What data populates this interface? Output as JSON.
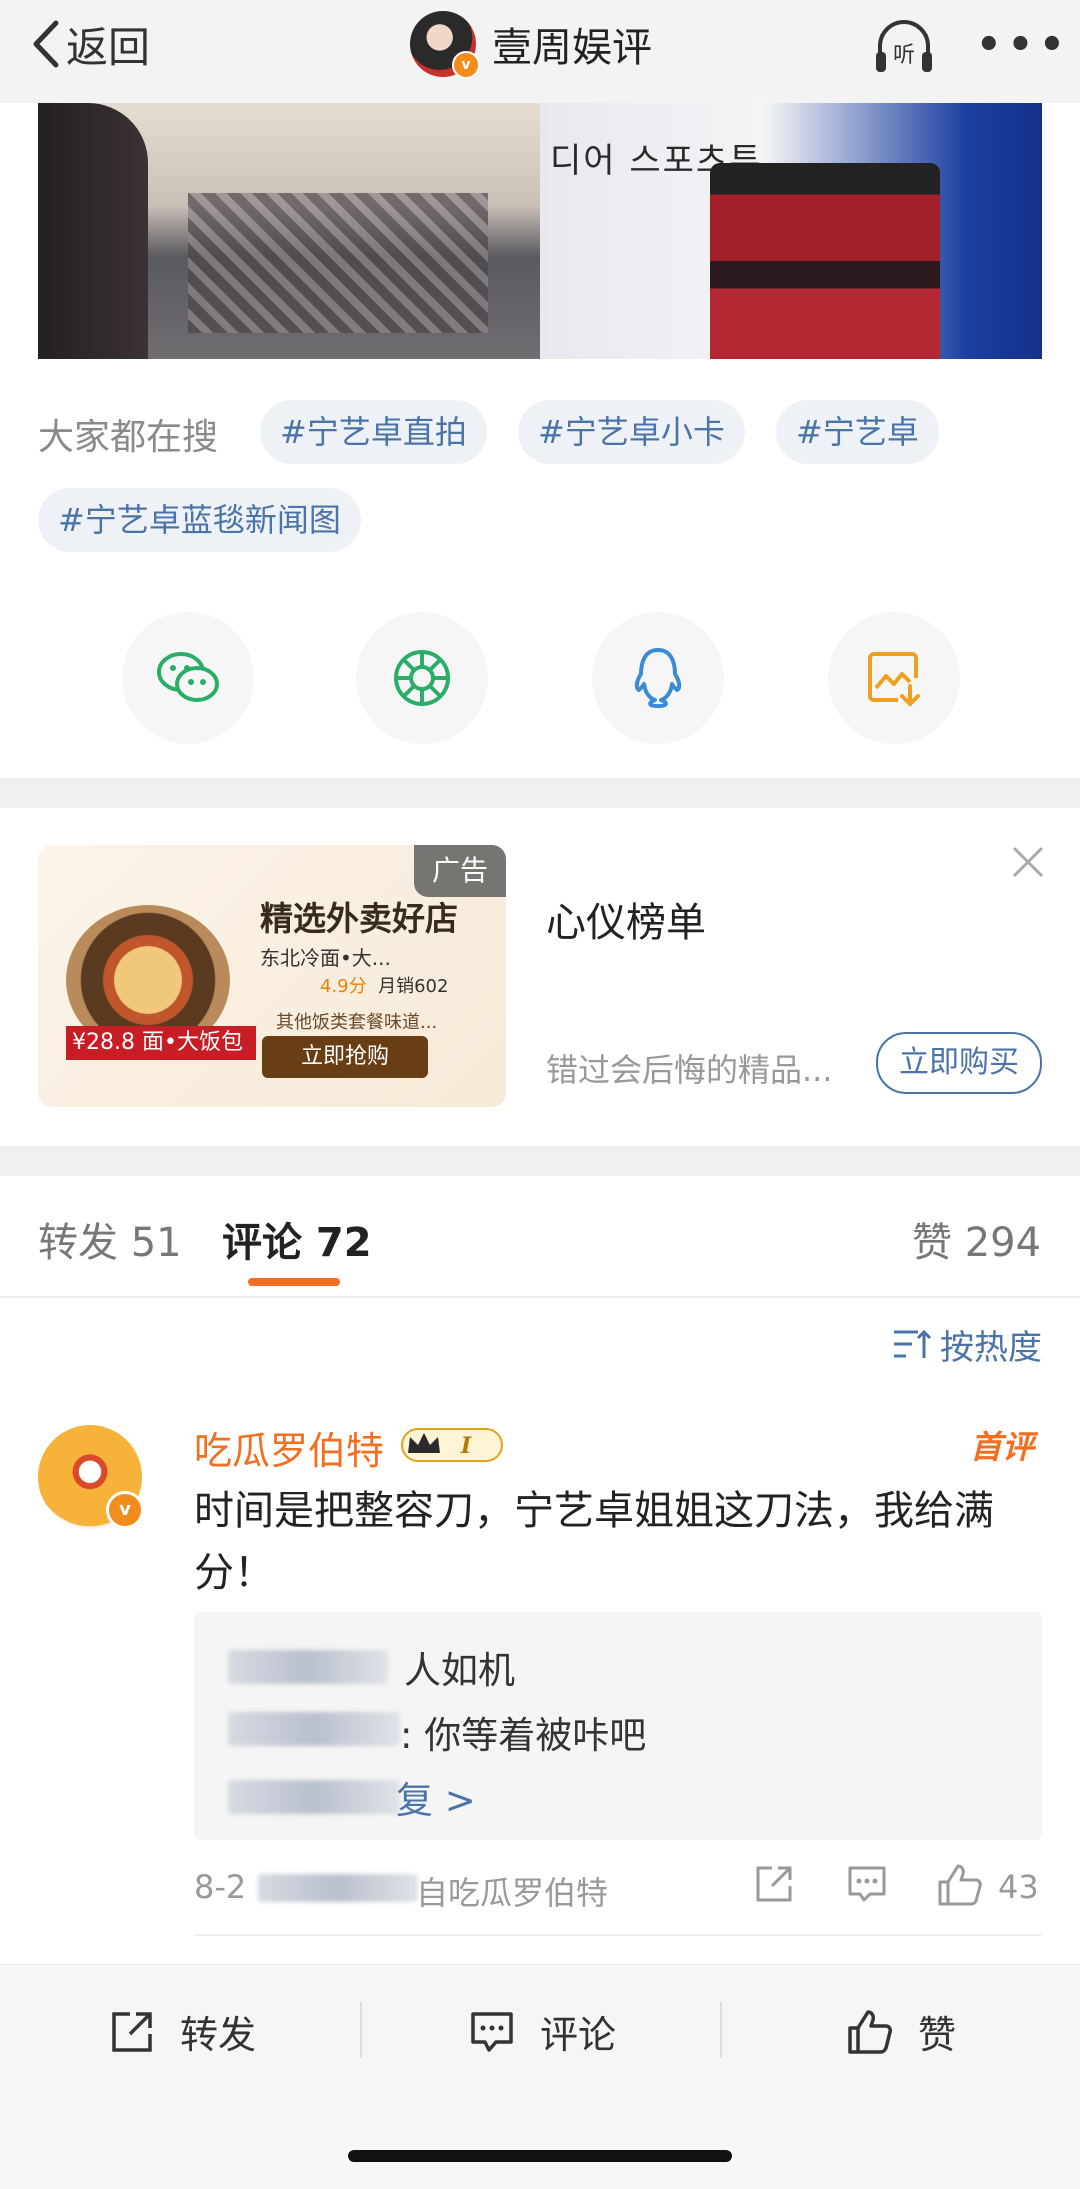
{
  "nav": {
    "back_label": "返回",
    "account_name": "壹周娱评",
    "listen_label": "听",
    "more_label": "•••"
  },
  "photo": {
    "sign_text": "디어 스포츠투"
  },
  "search": {
    "label": "大家都在搜",
    "tags": [
      "#宁艺卓直拍",
      "#宁艺卓小卡",
      "#宁艺卓",
      "#宁艺卓蓝毯新闻图"
    ]
  },
  "share": {
    "icons": [
      "wechat-icon",
      "moments-icon",
      "qq-icon",
      "save-image-icon"
    ],
    "colors": {
      "wechat": "#2aae67",
      "moments": "#2aae67",
      "qq": "#3a8bd6",
      "save": "#f0a020"
    }
  },
  "ad": {
    "badge": "广告",
    "image_title": "精选外卖好店",
    "image_shop": "东北冷面•大...",
    "image_score": "4.9分",
    "image_sales": "月销602",
    "image_sub": "其他饭类套餐味道...",
    "image_button": "立即抢购",
    "image_price": "¥28.8",
    "image_price_tag": "面•大饭包",
    "name": "心仪榜单",
    "description": "错过会后悔的精品...",
    "cta": "立即购买"
  },
  "tabs": {
    "repost": "转发 51",
    "comment": "评论 72",
    "like": "赞 294"
  },
  "sort": {
    "label": "按热度"
  },
  "comment": {
    "username": "吃瓜罗伯特",
    "level": "I",
    "first_tag": "首评",
    "text": "时间是把整容刀，宁艺卓姐姐这刀法，我给满分！",
    "replies": [
      {
        "text": "人如机"
      },
      {
        "text": ": 你等着被咔吧"
      },
      {
        "text": "复 >"
      }
    ],
    "meta": "8-2",
    "meta_source": "自吃瓜罗伯特",
    "like_count": "43"
  },
  "bottom": {
    "repost": "转发",
    "comment": "评论",
    "like": "赞"
  }
}
